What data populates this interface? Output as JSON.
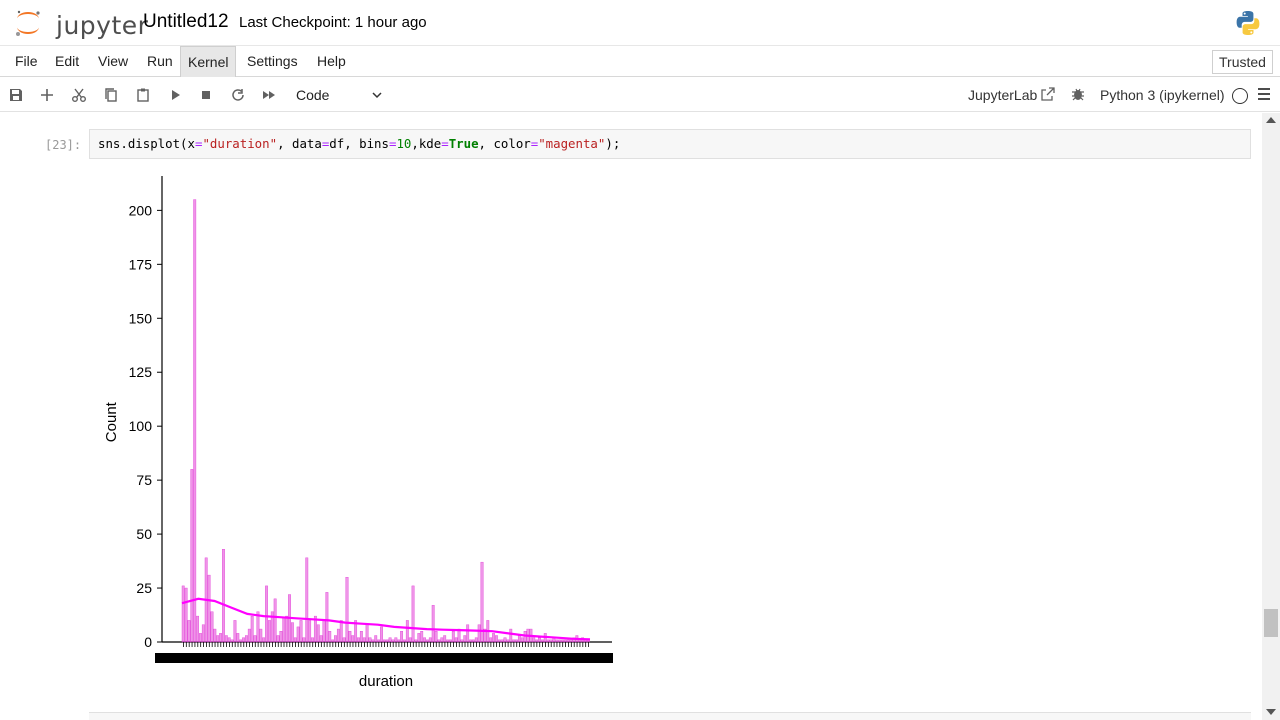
{
  "header": {
    "logo_text": "jupyter",
    "notebook_name": "Untitled12",
    "checkpoint": "Last Checkpoint: 1 hour ago"
  },
  "menu": {
    "items": [
      "File",
      "Edit",
      "View",
      "Run",
      "Kernel",
      "Settings",
      "Help"
    ],
    "active": "Kernel",
    "trusted": "Trusted"
  },
  "toolbar": {
    "icons": [
      "save-icon",
      "add-cell-icon",
      "cut-icon",
      "copy-icon",
      "paste-icon",
      "run-icon",
      "stop-icon",
      "restart-icon",
      "fast-forward-icon"
    ],
    "cell_type": "Code",
    "jupyterlab_label": "JupyterLab",
    "kernel_name": "Python 3 (ipykernel)"
  },
  "cell": {
    "prompt": "[23]:",
    "code": "sns.displot(x=\"duration\", data=df, bins=10,kde=True, color=\"magenta\");"
  },
  "chart_data": {
    "type": "bar",
    "title": "",
    "xlabel": "duration",
    "ylabel": "Count",
    "ylim": [
      0,
      215
    ],
    "yticks": [
      0,
      25,
      50,
      75,
      100,
      125,
      150,
      175,
      200
    ],
    "color": "#e13cd6",
    "kde_color": "#ff00ff",
    "values": [
      26,
      25,
      10,
      80,
      205,
      12,
      4,
      8,
      39,
      31,
      14,
      6,
      3,
      4,
      43,
      3,
      2,
      1,
      10,
      4,
      1,
      2,
      3,
      6,
      12,
      3,
      14,
      6,
      2,
      26,
      10,
      14,
      20,
      3,
      5,
      11,
      12,
      22,
      9,
      2,
      7,
      10,
      2,
      39,
      10,
      2,
      12,
      8,
      3,
      10,
      23,
      5,
      1,
      3,
      6,
      10,
      2,
      30,
      5,
      3,
      10,
      2,
      5,
      2,
      8,
      2,
      1,
      3,
      1,
      7,
      1,
      1,
      2,
      1,
      2,
      1,
      5,
      1,
      10,
      2,
      26,
      1,
      4,
      5,
      2,
      1,
      2,
      17,
      5,
      1,
      2,
      3,
      1,
      1,
      5,
      2,
      6,
      1,
      3,
      8,
      1,
      1,
      2,
      8,
      37,
      6,
      10,
      2,
      4,
      3,
      1,
      1,
      2,
      1,
      6,
      1,
      1,
      3,
      2,
      5,
      6,
      6,
      2,
      1,
      2,
      1,
      4,
      1,
      1,
      2,
      1,
      1,
      1,
      1,
      1,
      1,
      2,
      3,
      1,
      2,
      1,
      1
    ],
    "kde": [
      18,
      20,
      19,
      16,
      13,
      12,
      11.5,
      11,
      10.5,
      10,
      9,
      8.5,
      8,
      7,
      6.5,
      6,
      5.7,
      5.5,
      5.3,
      5,
      4,
      3,
      2.5,
      2,
      1.5,
      1.2
    ]
  }
}
